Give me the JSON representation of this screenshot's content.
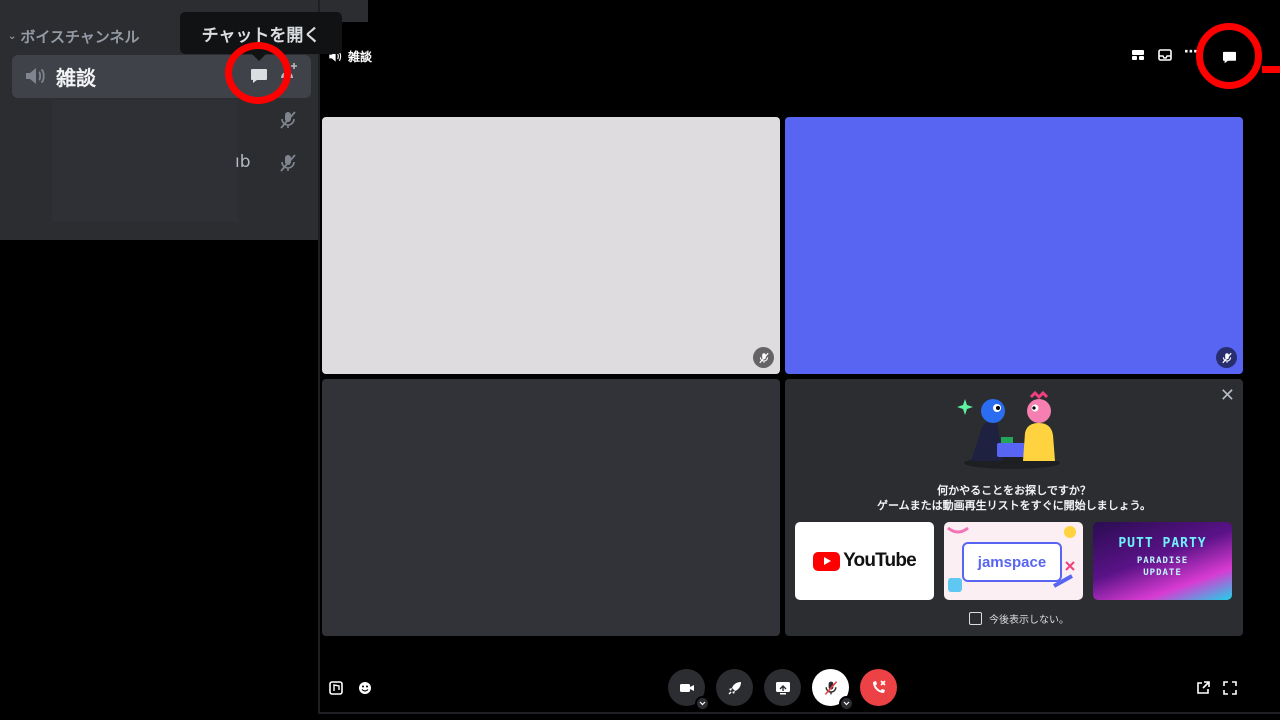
{
  "sidebar": {
    "category_label": "ボイスチャンネル",
    "channel_name": "雑談",
    "member_suffix": "ıb"
  },
  "tooltip": {
    "text": "チャットを開く"
  },
  "topbar": {
    "channel_name": "雑談"
  },
  "activities": {
    "title": "何かやることをお探しですか？",
    "subtitle": "ゲームまたは動画再生リストをすぐに開始しましょう。",
    "cards": {
      "youtube": "YouTube",
      "jamspace": "jamspace",
      "putt_party_line1": "PUTT PARTY",
      "putt_party_line2": "PARADISE",
      "putt_party_line3": "UPDATE"
    },
    "dont_show_label": "今後表示しない。"
  },
  "colors": {
    "discord_blurple": "#5865f2",
    "hangup_red": "#ed4245",
    "highlight_ring": "#ff0000",
    "tile_light": "#dfdcdf",
    "tile_dark": "#313338"
  },
  "icons": {
    "speaker": "speaker-icon",
    "chat": "chat-bubble-icon",
    "mic_muted": "mic-muted-icon",
    "camera": "camera-icon",
    "rocket": "rocket-icon",
    "screen_share": "screen-share-icon",
    "hangup": "phone-hangup-icon",
    "close": "close-icon",
    "popout": "popout-icon",
    "fullscreen": "fullscreen-icon"
  }
}
